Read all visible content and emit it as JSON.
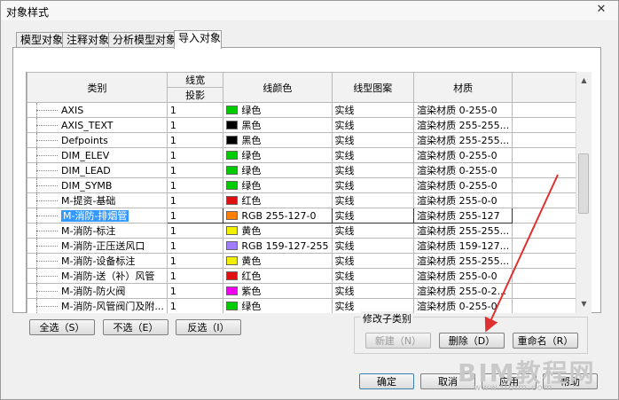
{
  "window": {
    "title": "对象样式",
    "close_glyph": "✕"
  },
  "tabs": [
    {
      "label": "模型对象"
    },
    {
      "label": "注释对象"
    },
    {
      "label": "分析模型对象"
    },
    {
      "label": "导入对象",
      "active": true
    }
  ],
  "table": {
    "headers": {
      "category": "类别",
      "line_width": "线宽",
      "projection": "投影",
      "line_color": "线颜色",
      "line_pattern": "线型图案",
      "material": "材质"
    },
    "rows": [
      {
        "name": "AXIS",
        "width": "1",
        "color_hex": "#00cc00",
        "color_name": "绿色",
        "pattern": "实线",
        "material": "渲染材质 0-255-0"
      },
      {
        "name": "AXIS_TEXT",
        "width": "1",
        "color_hex": "#000000",
        "color_name": "黑色",
        "pattern": "实线",
        "material": "渲染材质 255-255..."
      },
      {
        "name": "Defpoints",
        "width": "1",
        "color_hex": "#000000",
        "color_name": "黑色",
        "pattern": "实线",
        "material": "渲染材质 255-255..."
      },
      {
        "name": "DIM_ELEV",
        "width": "1",
        "color_hex": "#00cc00",
        "color_name": "绿色",
        "pattern": "实线",
        "material": "渲染材质 0-255-0"
      },
      {
        "name": "DIM_LEAD",
        "width": "1",
        "color_hex": "#00cc00",
        "color_name": "绿色",
        "pattern": "实线",
        "material": "渲染材质 0-255-0"
      },
      {
        "name": "DIM_SYMB",
        "width": "1",
        "color_hex": "#00cc00",
        "color_name": "绿色",
        "pattern": "实线",
        "material": "渲染材质 0-255-0"
      },
      {
        "name": "M-提资-基础",
        "width": "1",
        "color_hex": "#e01010",
        "color_name": "红色",
        "pattern": "实线",
        "material": "渲染材质 255-0-0"
      },
      {
        "name": "M-消防-排烟管",
        "width": "1",
        "color_hex": "#ff8000",
        "color_name": "RGB 255-127-0",
        "pattern": "实线",
        "material": "渲染材质 255-127",
        "selected": true
      },
      {
        "name": "M-消防-标注",
        "width": "1",
        "color_hex": "#f0f000",
        "color_name": "黄色",
        "pattern": "实线",
        "material": "渲染材质 255-255..."
      },
      {
        "name": "M-消防-正压送风口",
        "width": "1",
        "color_hex": "#9f7fff",
        "color_name": "RGB 159-127-255",
        "pattern": "实线",
        "material": "渲染材质 159-127..."
      },
      {
        "name": "M-消防-设备标注",
        "width": "1",
        "color_hex": "#f0f000",
        "color_name": "黄色",
        "pattern": "实线",
        "material": "渲染材质 255-255..."
      },
      {
        "name": "M-消防-送（补）风管",
        "width": "1",
        "color_hex": "#e01010",
        "color_name": "红色",
        "pattern": "实线",
        "material": "渲染材质 255-0-0"
      },
      {
        "name": "M-消防-防火阀",
        "width": "1",
        "color_hex": "#ee00ee",
        "color_name": "紫色",
        "pattern": "实线",
        "material": "渲染材质 255-0-2..."
      },
      {
        "name": "M-消防-风管阀门及附...",
        "width": "1",
        "color_hex": "#00cc00",
        "color_name": "绿色",
        "pattern": "实线",
        "material": "渲染材质 0-255-0"
      }
    ]
  },
  "selection_buttons": {
    "select_all": "全选（S）",
    "select_none": "不选（E）",
    "invert": "反选（I）"
  },
  "subcategory": {
    "label": "修改子类别",
    "new": "新建（N）",
    "delete": "删除（D）",
    "rename": "重命名（R）"
  },
  "footer": {
    "ok": "确定",
    "cancel": "取消",
    "apply": "应用",
    "help": "帮助"
  },
  "watermark": {
    "text": "BIM教程网",
    "url": "www.lfbim.com"
  },
  "colors": {
    "selection": "#3399ff",
    "arrow": "#e03030"
  }
}
